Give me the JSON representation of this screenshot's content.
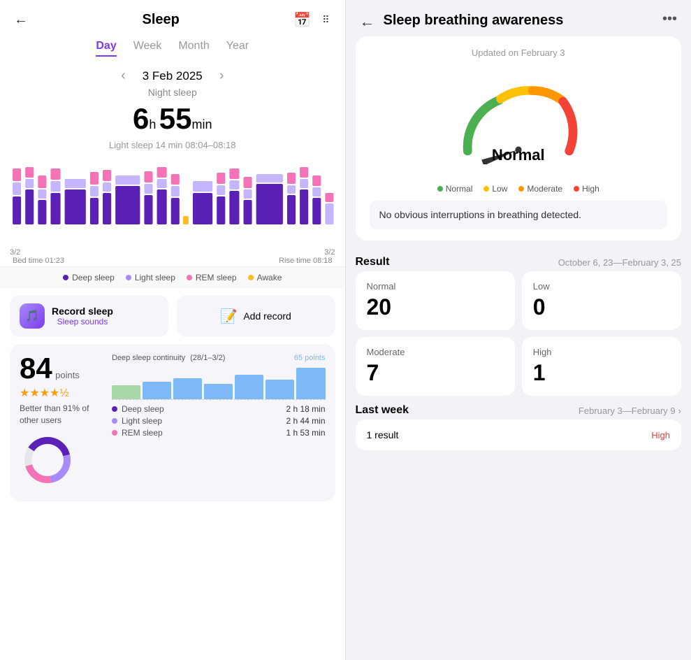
{
  "left": {
    "header": {
      "title": "Sleep",
      "back_icon": "←",
      "calendar_icon": "📅",
      "more_icon": "⋮⋮"
    },
    "tabs": [
      "Day",
      "Week",
      "Month",
      "Year"
    ],
    "active_tab": "Day",
    "date": "3 Feb 2025",
    "night_sleep": "Night sleep",
    "duration_hours": "6",
    "h_label": "h",
    "duration_mins": "55",
    "min_label": "min",
    "light_sleep_info": "Light sleep 14 min 08:04–08:18",
    "chart_start_label": "3/2",
    "chart_end_label": "3/2",
    "bed_time": "Bed time 01:23",
    "rise_time": "Rise time 08:18",
    "legend": [
      {
        "label": "Deep sleep",
        "color": "#5b21b6"
      },
      {
        "label": "Light sleep",
        "color": "#a78bfa"
      },
      {
        "label": "REM sleep",
        "color": "#f472b6"
      },
      {
        "label": "Awake",
        "color": "#fbbf24"
      }
    ],
    "record_sleep": {
      "title": "Record sleep",
      "sub": "Sleep sounds"
    },
    "add_record": "Add record",
    "score_card": {
      "points": "84",
      "points_label": "points",
      "stars": "★★★★½",
      "better_than": "Better than 91% of\nother users",
      "deep_sleep_chart_title": "Deep sleep continuity",
      "deep_sleep_date": "(28/1–3/2)",
      "points_value": "65 points",
      "breakdown": [
        {
          "label": "Deep sleep",
          "color": "#5b21b6",
          "value": "2 h 18 min"
        },
        {
          "label": "Light sleep",
          "color": "#a78bfa",
          "value": "2 h 44 min"
        },
        {
          "label": "REM sleep",
          "color": "#f472b6",
          "value": "1 h 53 min"
        }
      ]
    }
  },
  "right": {
    "header": {
      "back_icon": "←",
      "title": "Sleep breathing\nawareness",
      "more_icon": "•••"
    },
    "gauge_card": {
      "updated_text": "Updated on February 3",
      "gauge_label": "Normal",
      "legend": [
        {
          "label": "Normal",
          "color": "#4caf50"
        },
        {
          "label": "Low",
          "color": "#ffc107"
        },
        {
          "label": "Moderate",
          "color": "#ff9800"
        },
        {
          "label": "High",
          "color": "#f44336"
        }
      ],
      "no_interruptions": "No obvious interruptions in breathing\ndetected."
    },
    "result_section": {
      "title": "Result",
      "date_range": "October 6, 23—February 3, 25"
    },
    "stats": [
      {
        "label": "Normal",
        "value": "20"
      },
      {
        "label": "Low",
        "value": "0"
      },
      {
        "label": "Moderate",
        "value": "7"
      },
      {
        "label": "High",
        "value": "1"
      }
    ],
    "last_week": {
      "title": "Last week",
      "date_range": "February 3—February 9"
    },
    "one_result": {
      "label": "1 result",
      "badge": "High"
    }
  }
}
